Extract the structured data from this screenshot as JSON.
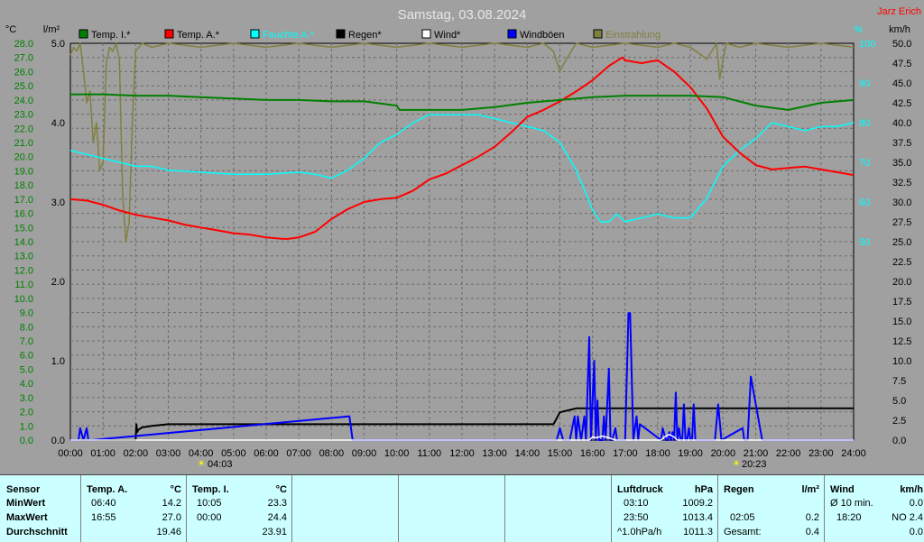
{
  "title": "Samstag, 03.08.2024",
  "station": "Jarz Erich",
  "units": {
    "left_temp": "°C",
    "left_rain": "l/m²",
    "right_hum": "%",
    "right_wind": "km/h"
  },
  "legend": [
    {
      "label": "Temp. I.*",
      "color": "#008000"
    },
    {
      "label": "Temp. A.*",
      "color": "#ff0000"
    },
    {
      "label": "Feuchte A.*",
      "color": "#00ffff"
    },
    {
      "label": "Regen*",
      "color": "#000000"
    },
    {
      "label": "Wind*",
      "color": "#ffffff"
    },
    {
      "label": "Windböen",
      "color": "#0000ff"
    },
    {
      "label": "Einstrahlung",
      "color": "#808040"
    }
  ],
  "sun": {
    "sunrise": "04:03",
    "sunset": "20:23"
  },
  "chart_data": {
    "type": "line",
    "grid": true,
    "x_ticks": [
      "00:00",
      "01:00",
      "02:00",
      "03:00",
      "04:00",
      "05:00",
      "06:00",
      "07:00",
      "08:00",
      "09:00",
      "10:00",
      "11:00",
      "12:00",
      "13:00",
      "14:00",
      "15:00",
      "16:00",
      "17:00",
      "18:00",
      "19:00",
      "20:00",
      "21:00",
      "22:00",
      "23:00",
      "24:00"
    ],
    "x_range": [
      0,
      24
    ],
    "axes": {
      "temp": {
        "range": [
          0,
          28
        ],
        "step": 1,
        "color": "#008000"
      },
      "rain": {
        "range": [
          0,
          5
        ],
        "ticks": [
          0.0,
          1.0,
          2.0,
          3.0,
          4.0,
          5.0
        ],
        "color": "#000000"
      },
      "humidity": {
        "range": [
          0,
          100
        ],
        "ticks": [
          50,
          60,
          70,
          80,
          90,
          100
        ],
        "color": "#00ffff"
      },
      "wind": {
        "range": [
          0,
          50
        ],
        "step": 2.5,
        "color": "#000000"
      }
    },
    "series": [
      {
        "name": "Einstrahlung",
        "axis": "humidity",
        "color": "#808040",
        "x": [
          0,
          0.1,
          0.2,
          0.3,
          0.4,
          0.5,
          0.6,
          0.7,
          0.8,
          0.9,
          1.0,
          1.1,
          1.2,
          1.3,
          1.4,
          1.5,
          1.6,
          1.7,
          1.8,
          1.9,
          2.0,
          2.2,
          2.5,
          3,
          4,
          5,
          6,
          7,
          8,
          9,
          10,
          11,
          12,
          13,
          14,
          14.5,
          14.8,
          15.0,
          15.2,
          15.5,
          16,
          17,
          18,
          18.5,
          19,
          19.5,
          19.8,
          19.9,
          20.0,
          20.1,
          20.5,
          21,
          22,
          23,
          24
        ],
        "y": [
          97,
          99,
          98,
          100,
          93,
          85,
          88,
          75,
          80,
          68,
          70,
          95,
          99,
          98,
          100,
          96,
          62,
          50,
          55,
          80,
          98,
          100,
          99,
          100,
          99,
          100,
          99,
          100,
          99,
          100,
          99,
          100,
          99,
          100,
          99,
          100,
          98,
          93,
          96,
          100,
          99,
          100,
          99,
          100,
          99,
          96,
          100,
          91,
          96,
          100,
          99,
          100,
          99,
          100,
          99
        ]
      },
      {
        "name": "Feuchte A.",
        "axis": "humidity",
        "color": "#00ffff",
        "x": [
          0,
          0.5,
          1,
          1.5,
          2,
          2.5,
          3,
          4,
          5,
          6,
          7,
          7.5,
          8,
          8.5,
          9,
          9.5,
          10,
          10.5,
          11,
          11.5,
          12,
          12.5,
          13,
          13.5,
          14,
          14.5,
          15,
          15.5,
          16,
          16.25,
          16.5,
          16.75,
          17,
          17.5,
          18,
          18.5,
          19,
          19.5,
          20,
          20.5,
          21,
          21.5,
          22,
          22.5,
          23,
          23.5,
          24
        ],
        "y": [
          73,
          72,
          71,
          70,
          69,
          69,
          68,
          67.5,
          67,
          67,
          67.5,
          67,
          66,
          68,
          71,
          75,
          77,
          80,
          82,
          82,
          82,
          82,
          81,
          80,
          79,
          78,
          75,
          68,
          58,
          55,
          55,
          57,
          55,
          56,
          57,
          56,
          56,
          61,
          69,
          73,
          76,
          80,
          79,
          78,
          79,
          79,
          80
        ]
      },
      {
        "name": "Temp. A.",
        "axis": "temp",
        "color": "#ff0000",
        "x": [
          0,
          0.5,
          1,
          1.5,
          2,
          2.5,
          3,
          3.5,
          4,
          4.5,
          5,
          5.5,
          6,
          6.5,
          6.667,
          7,
          7.5,
          8,
          8.5,
          9,
          9.5,
          10,
          10.5,
          11,
          11.5,
          12,
          12.5,
          13,
          13.5,
          14,
          14.5,
          15,
          15.5,
          16,
          16.5,
          16.917,
          17,
          17.5,
          18,
          18.5,
          19,
          19.5,
          20,
          20.5,
          21,
          21.5,
          22,
          22.5,
          23,
          23.5,
          24
        ],
        "y": [
          17.0,
          16.9,
          16.6,
          16.2,
          15.9,
          15.7,
          15.5,
          15.2,
          15.0,
          14.8,
          14.6,
          14.5,
          14.3,
          14.2,
          14.2,
          14.3,
          14.7,
          15.6,
          16.3,
          16.8,
          17.0,
          17.1,
          17.6,
          18.4,
          18.8,
          19.4,
          20.0,
          20.7,
          21.7,
          22.8,
          23.3,
          23.9,
          24.6,
          25.4,
          26.4,
          27.0,
          26.8,
          26.6,
          26.8,
          26.0,
          24.9,
          23.4,
          21.4,
          20.3,
          19.4,
          19.1,
          19.2,
          19.3,
          19.1,
          18.9,
          18.7
        ]
      },
      {
        "name": "Temp. I.",
        "axis": "temp",
        "color": "#008000",
        "x": [
          0,
          1,
          2,
          3,
          4,
          5,
          6,
          7,
          8,
          9,
          10,
          10.083,
          11,
          12,
          13,
          14,
          15,
          16,
          17,
          18,
          19,
          20,
          21,
          22,
          23,
          24
        ],
        "y": [
          24.4,
          24.4,
          24.3,
          24.3,
          24.2,
          24.1,
          24.0,
          24.0,
          23.9,
          23.9,
          23.6,
          23.3,
          23.3,
          23.3,
          23.5,
          23.8,
          24.0,
          24.2,
          24.3,
          24.3,
          24.3,
          24.2,
          23.6,
          23.3,
          23.8,
          24.0
        ]
      },
      {
        "name": "Regen",
        "axis": "rain",
        "color": "#000000",
        "x": [
          0,
          2.0,
          2.02,
          2.05,
          2.08,
          2.2,
          2.5,
          3,
          3.5,
          4,
          5,
          6,
          7,
          8,
          9,
          10,
          11,
          12,
          13,
          14,
          14.8,
          14.83,
          15,
          15.5,
          16,
          17,
          18,
          19,
          20,
          21,
          22,
          23,
          24
        ],
        "y": [
          0,
          0,
          0.2,
          0.1,
          0.13,
          0.16,
          0.18,
          0.2,
          0.2,
          0.2,
          0.2,
          0.2,
          0.2,
          0.2,
          0.2,
          0.2,
          0.2,
          0.2,
          0.2,
          0.2,
          0.2,
          0.22,
          0.35,
          0.4,
          0.4,
          0.4,
          0.4,
          0.4,
          0.4,
          0.4,
          0.4,
          0.4,
          0.4
        ]
      },
      {
        "name": "Windböen",
        "axis": "wind",
        "color": "#0000ff",
        "x": [
          0,
          0.25,
          0.3,
          0.4,
          0.5,
          0.55,
          0.65,
          8.55,
          8.65,
          8.75,
          14.9,
          15.0,
          15.1,
          15.3,
          15.45,
          15.5,
          15.55,
          15.65,
          15.75,
          15.8,
          15.9,
          15.95,
          16.05,
          16.1,
          16.15,
          16.2,
          16.3,
          16.35,
          16.4,
          16.5,
          16.55,
          16.6,
          16.7,
          16.75,
          16.8,
          17.0,
          17.1,
          17.15,
          17.25,
          17.35,
          17.4,
          17.45,
          18.1,
          18.15,
          18.25,
          18.3,
          18.35,
          18.4,
          18.45,
          18.5,
          18.55,
          18.6,
          18.65,
          18.7,
          18.75,
          18.8,
          18.85,
          18.9,
          18.95,
          19.0,
          19.05,
          19.1,
          19.15,
          19.25,
          19.75,
          19.85,
          19.95,
          20.6,
          20.65,
          20.75,
          20.85,
          21.2,
          21.35,
          21.45,
          21.5,
          24
        ],
        "y": [
          0,
          0,
          1.5,
          0,
          1.5,
          0,
          0,
          3,
          0,
          0,
          0,
          1.5,
          0,
          0,
          3,
          0,
          3,
          0,
          3,
          0,
          13,
          0,
          10,
          0,
          5,
          0,
          0,
          3,
          0,
          9,
          0,
          0,
          1.5,
          0,
          0,
          0,
          16,
          16,
          0,
          3,
          0,
          2,
          0,
          1.5,
          0,
          0,
          1,
          0,
          1,
          0,
          6,
          0,
          1.5,
          0,
          0,
          4.5,
          0,
          0,
          1.5,
          0,
          0,
          4.5,
          0,
          0,
          0,
          4.5,
          0,
          1.5,
          0,
          0,
          8,
          0,
          0,
          0,
          0,
          0
        ]
      },
      {
        "name": "Wind",
        "axis": "wind",
        "color": "#ffffff",
        "x": [
          0,
          15.9,
          16.0,
          16.1,
          16.3,
          16.5,
          16.7,
          18.1,
          18.2,
          18.35,
          18.5,
          18.6,
          24
        ],
        "y": [
          0,
          0,
          0.4,
          0.3,
          0.5,
          0.3,
          0,
          0,
          0.4,
          0.7,
          0.4,
          0,
          0
        ]
      }
    ]
  },
  "summary": {
    "row_labels": [
      "Sensor",
      "MinWert",
      "MaxWert",
      "Durchschnitt"
    ],
    "temp_a": {
      "header": "Temp. A.",
      "unit": "°C",
      "times": [
        "06:40",
        "16:55",
        ""
      ],
      "values": [
        "14.2",
        "27.0",
        "19.46"
      ]
    },
    "temp_i": {
      "header": "Temp. I.",
      "unit": "°C",
      "times": [
        "10:05",
        "00:00",
        ""
      ],
      "values": [
        "23.3",
        "24.4",
        "23.91"
      ]
    },
    "pressure": {
      "header": "Luftdruck",
      "unit": "hPa",
      "times": [
        "03:10",
        "23:50",
        "^1.0hPa/h"
      ],
      "values": [
        "1009.2",
        "1013.4",
        "1011.3"
      ]
    },
    "rain": {
      "header": "Regen",
      "unit": "l/m²",
      "times": [
        "",
        "02:05",
        "Gesamt:"
      ],
      "values": [
        "",
        "0.2",
        "0.4"
      ]
    },
    "wind": {
      "header": "Wind",
      "unit": "km/h",
      "times": [
        "Ø 10 min.",
        "18:20",
        ""
      ],
      "values": [
        "0.0",
        "NO 2.4",
        "0.0"
      ]
    }
  }
}
